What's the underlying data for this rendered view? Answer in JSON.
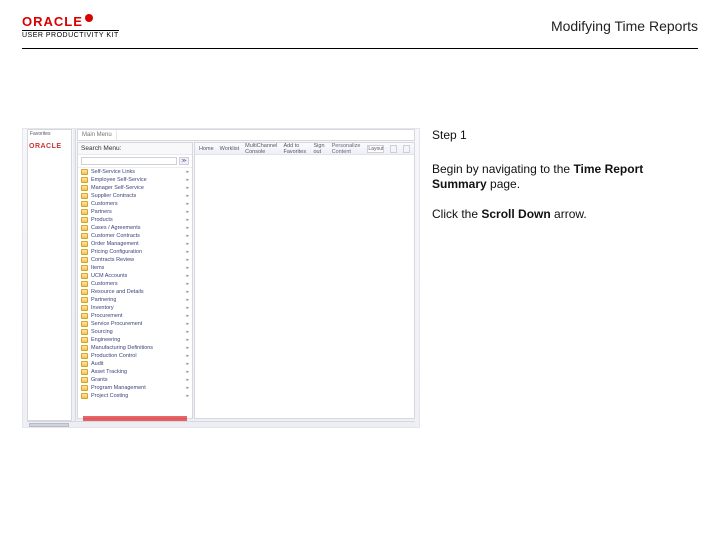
{
  "header": {
    "logo_brand": "ORACLE",
    "logo_sub": "USER PRODUCTIVITY KIT",
    "page_title": "Modifying Time Reports"
  },
  "instructions": {
    "step_label": "Step 1",
    "line1_pre": "Begin by navigating to the ",
    "line1_bold": "Time Report Summary",
    "line1_post": " page.",
    "line2_pre": "Click the ",
    "line2_bold": "Scroll Down",
    "line2_post": " arrow."
  },
  "app": {
    "corp_label": "ORACLE",
    "fav_tab": "Favorites",
    "main_tab": "Main Menu",
    "search_header": "Search Menu:",
    "search_go": "≫",
    "toolbar": {
      "home": "Home",
      "worklist": "Worklist",
      "mcf": "MultiChannel Console",
      "addfav": "Add to Favorites",
      "signout": "Sign out",
      "caption": "Personalize Content",
      "layout": "Layout"
    },
    "folders": [
      "Self-Service Links",
      "Employee Self-Service",
      "Manager Self-Service",
      "Supplier Contracts",
      "Customers",
      "Partners",
      "Products",
      "Cases / Agreements",
      "Customer Contracts",
      "Order Management",
      "Pricing Configuration",
      "Contracts Review",
      "Items",
      "UCM Accounts",
      "Customers",
      "Resource and Details",
      "Partnering",
      "Inventory",
      "Procurement",
      "Service Procurement",
      "Sourcing",
      "Engineering",
      "Manufacturing Definitions",
      "Production Control",
      "Audit",
      "Asset Tracking",
      "Grants",
      "Program Management",
      "Project Costing"
    ]
  }
}
